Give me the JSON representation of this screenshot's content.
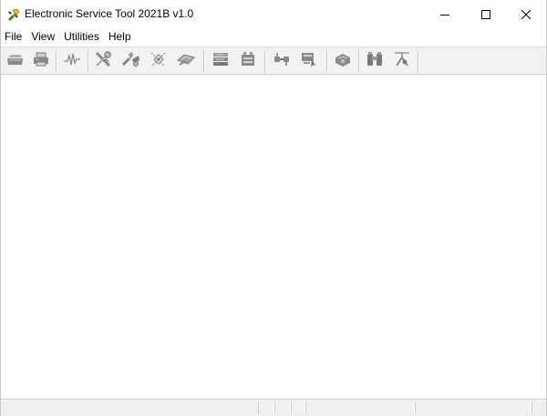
{
  "window": {
    "title": "Electronic Service Tool 2021B v1.0",
    "controls": {
      "minimize_icon": "minimize-icon",
      "maximize_icon": "maximize-icon",
      "close_icon": "close-icon"
    }
  },
  "menu": {
    "items": [
      {
        "label": "File"
      },
      {
        "label": "View"
      },
      {
        "label": "Utilities"
      },
      {
        "label": "Help"
      }
    ]
  },
  "toolbar": {
    "icon_color": "#8a8a8a",
    "buttons": [
      {
        "icon": "open-folder-icon"
      },
      {
        "icon": "print-icon"
      },
      {
        "icon": "status-waveform-icon"
      },
      {
        "icon": "diagnostic-tool-icon"
      },
      {
        "icon": "service-tool-icon"
      },
      {
        "icon": "calibration-icon"
      },
      {
        "icon": "flash-program-icon"
      },
      {
        "icon": "document-stack-icon"
      },
      {
        "icon": "data-log-icon"
      },
      {
        "icon": "configuration-icon"
      },
      {
        "icon": "test-icon"
      },
      {
        "icon": "module-info-icon"
      },
      {
        "icon": "binoculars-icon"
      },
      {
        "icon": "connect-icon"
      }
    ]
  },
  "statusbar": {
    "panes": [
      "",
      "",
      "",
      "",
      "",
      ""
    ]
  }
}
